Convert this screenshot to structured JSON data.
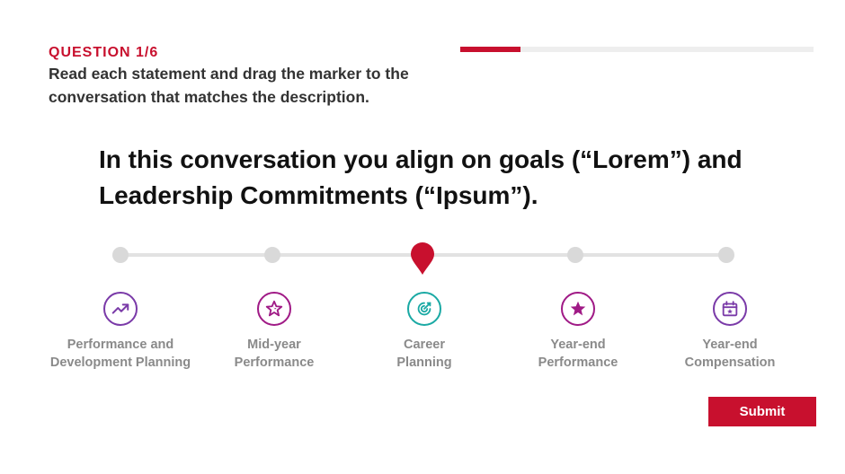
{
  "question": {
    "label": "QUESTION 1/6",
    "progress": 0.17
  },
  "instructions": "Read each statement and drag the marker to the conversation that matches the description.",
  "statement": "In this conversation you align on goals (“Lorem”) and Leadership Commitments (“Ipsum”).",
  "slider": {
    "selected_index": 2
  },
  "options": [
    {
      "line1": "Performance and",
      "line2": "Development Planning",
      "icon": "trend-up-icon",
      "color": "#7a3aa8"
    },
    {
      "line1": "Mid-year",
      "line2": "Performance",
      "icon": "star-outline-icon",
      "color": "#a01a86"
    },
    {
      "line1": "Career",
      "line2": "Planning",
      "icon": "target-icon",
      "color": "#1aa9a4"
    },
    {
      "line1": "Year-end",
      "line2": "Performance",
      "icon": "star-filled-icon",
      "color": "#a01a86"
    },
    {
      "line1": "Year-end",
      "line2": "Compensation",
      "icon": "calendar-icon",
      "color": "#7a3aa8"
    }
  ],
  "submit_label": "Submit",
  "colors": {
    "accent": "#c8102e",
    "track": "#e2e2e2",
    "label_gray": "#8a8a8a"
  }
}
